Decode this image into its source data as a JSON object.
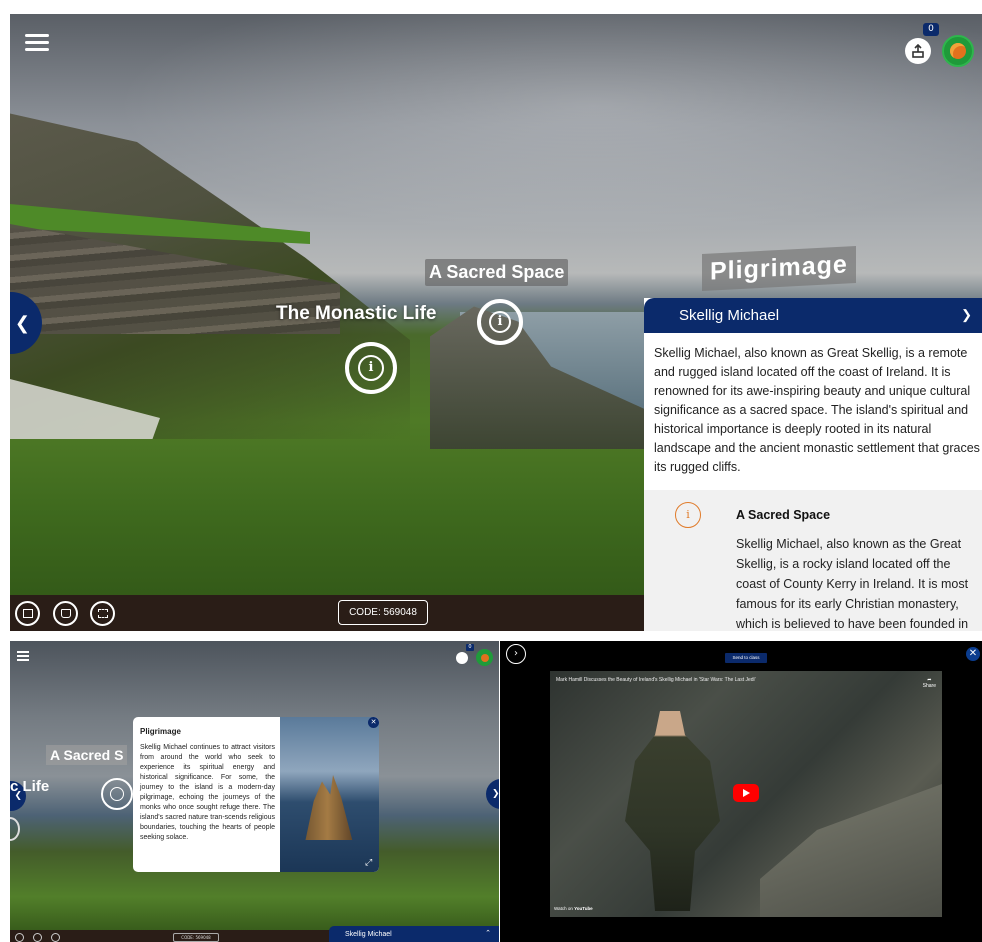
{
  "top": {
    "badge_count": "0",
    "hotspots": {
      "sacred_space": "A Sacred Space",
      "monastic_life": "The Monastic Life",
      "pilgrimage": "Pligrimage"
    },
    "code_label": "CODE: 569048",
    "side_panel": {
      "title": "Skellig Michael",
      "intro": "Skellig Michael, also known as Great Skellig, is a remote and rugged island located off the coast of Ireland. It is renowned for its awe-inspiring beauty and unique cultural significance as a sacred space. The island's spiritual and historical importance is deeply rooted in its natural landscape and the ancient monastic settlement that graces its rugged cliffs.",
      "section_title": "A Sacred Space",
      "section_body": "Skellig Michael, also known as the Great Skellig, is a rocky island located off the coast of County Kerry in Ireland. It is most famous for its early Christian monastery, which is believed to have been founded in"
    },
    "icons": {
      "menu": "menu-icon",
      "share": "share-icon",
      "avatar": "avatar",
      "nav_prev": "chevron-left-icon",
      "info": "info-icon",
      "gallery": "image-icon",
      "book": "book-icon",
      "fullscreen": "fullscreen-icon",
      "collapse": "chevron-down-icon"
    },
    "colors": {
      "brand": "#0b2a6b",
      "accent": "#e07b2a",
      "avatar": "#1f9a3a"
    }
  },
  "bottom_left": {
    "badge_count": "0",
    "hotspot_sacred": "A Sacred S",
    "hotspot_life": "c Life",
    "modal": {
      "title": "Pligrimage",
      "body": "Skellig Michael continues to attract visitors from around the world who seek to experience its spiritual energy and historical significance. For some, the journey to the island is a modern-day pilgrimage, echoing the journeys of the monks who once sought refuge there. The island's sacred nature tran-scends religious boundaries, touching the hearts of people seeking solace."
    },
    "code_label": "CODE: 569048",
    "panel_title": "Skellig Michael"
  },
  "bottom_right": {
    "send_label": "Send to class",
    "video_title": "Mark Hamill Discusses the Beauty of Ireland's Skellig Michael in 'Star Wars: The Last Jedi'",
    "share_label": "Share",
    "watch_label": "Watch on",
    "yt_logo": "YouTube"
  }
}
